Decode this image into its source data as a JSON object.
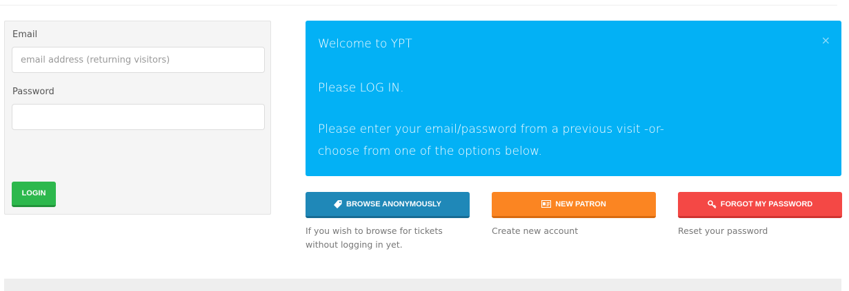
{
  "login": {
    "email_label": "Email",
    "email_placeholder": "email address (returning visitors)",
    "email_value": "",
    "password_label": "Password",
    "password_value": "",
    "login_button": "LOGIN"
  },
  "alert": {
    "title": "Welcome to YPT",
    "line1": "Please LOG IN.",
    "line2": "Please enter your email/password from a previous visit -or-",
    "line3": "choose from one of the options below.",
    "close_symbol": "×"
  },
  "actions": [
    {
      "label": "BROWSE ANONYMOUSLY",
      "icon": "tag-icon",
      "description": "If you wish to browse for tickets without logging in yet."
    },
    {
      "label": "NEW PATRON",
      "icon": "id-card-icon",
      "description": "Create new account"
    },
    {
      "label": "FORGOT MY PASSWORD",
      "icon": "key-icon",
      "description": "Reset your password"
    }
  ],
  "colors": {
    "login_green": "#2db84d",
    "alert_blue": "#03b1f5",
    "browse_blue": "#1f88b8",
    "patron_orange": "#fb8522",
    "forgot_red": "#f44845"
  }
}
